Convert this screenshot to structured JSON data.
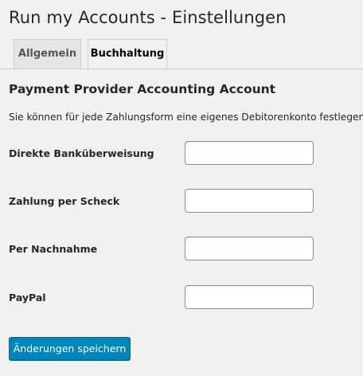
{
  "page": {
    "title": "Run my Accounts - Einstellungen"
  },
  "tabs": [
    {
      "label": "Allgemein",
      "active": false
    },
    {
      "label": "Buchhaltung",
      "active": true
    }
  ],
  "section": {
    "title": "Payment Provider Accounting Account",
    "description": "Sie können für jede Zahlungsform eine eigenes Debitorenkonto festlegen."
  },
  "fields": [
    {
      "label": "Direkte Banküberweisung",
      "value": ""
    },
    {
      "label": "Zahlung per Scheck",
      "value": ""
    },
    {
      "label": "Per Nachnahme",
      "value": ""
    },
    {
      "label": "PayPal",
      "value": ""
    }
  ],
  "actions": {
    "save_label": "Änderungen speichern"
  },
  "colors": {
    "background": "#f1f1f1",
    "primary_button": "#0085ba",
    "text": "#23282d",
    "tab_inactive": "#e5e5e5"
  }
}
